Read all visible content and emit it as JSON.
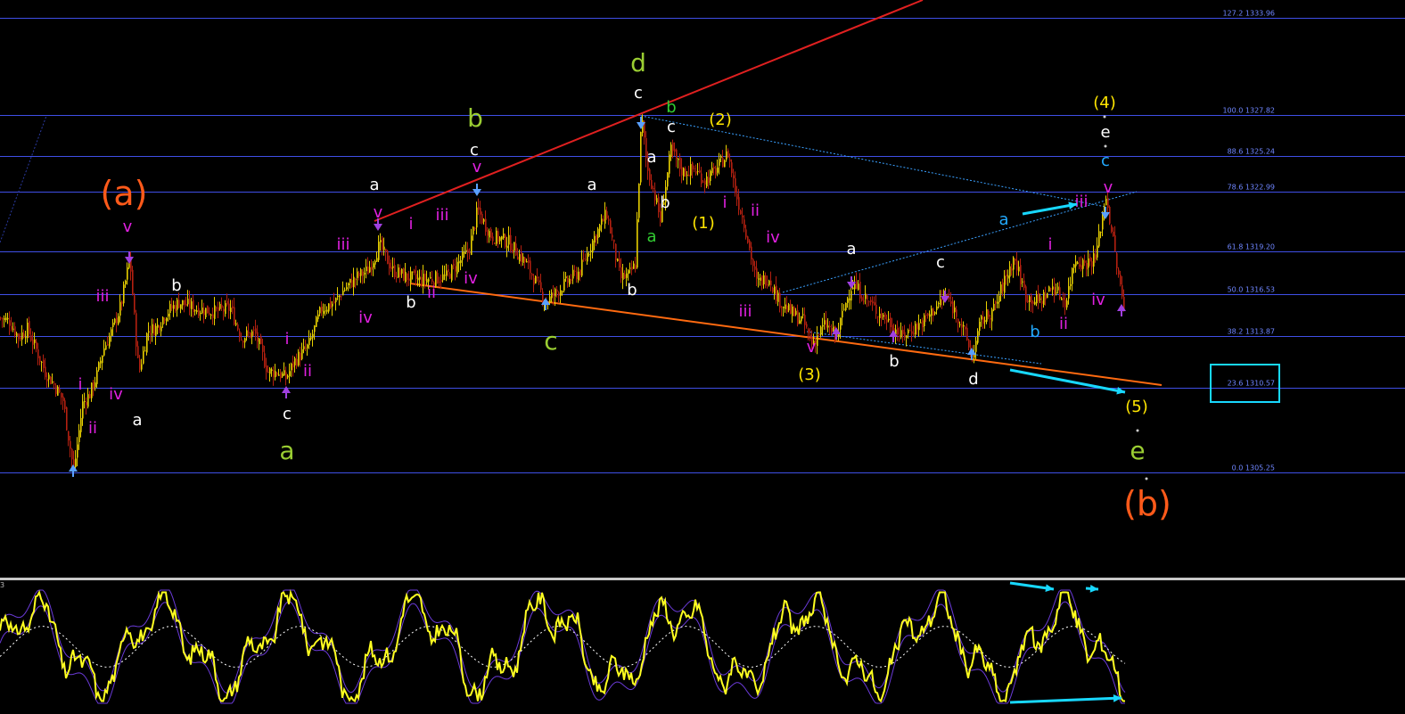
{
  "oscillator": {
    "label": "3"
  },
  "colors": {
    "background": "#000000",
    "fib_line": "#3f4fe6",
    "fib_text": "#6f86ff",
    "up_candle": "#e8d000",
    "down_candle": "#b32010",
    "channel_upper": "#e02020",
    "channel_lower": "#ff6a10",
    "dotted_line": "#3aa0ff",
    "arrow": "#18d8ff",
    "osc_main": "#ffff20",
    "osc_band": "#6a3ad8",
    "osc_signal": "#ffffff"
  },
  "chart_data": {
    "type": "candlestick",
    "fib_levels": [
      {
        "ratio": "127.2",
        "price": "1333.96",
        "label": "127.2 1333.96"
      },
      {
        "ratio": "100.0",
        "price": "1327.82",
        "label": "100.0 1327.82"
      },
      {
        "ratio": "88.6",
        "price": "1325.24",
        "label": "88.6 1325.24"
      },
      {
        "ratio": "78.6",
        "price": "1322.99",
        "label": "78.6 1322.99"
      },
      {
        "ratio": "61.8",
        "price": "1319.20",
        "label": "61.8 1319.20"
      },
      {
        "ratio": "50.0",
        "price": "1316.53",
        "label": "50.0 1316.53"
      },
      {
        "ratio": "38.2",
        "price": "1313.87",
        "label": "38.2 1313.87"
      },
      {
        "ratio": "23.6",
        "price": "1310.57",
        "label": "23.6 1310.57"
      },
      {
        "ratio": "0.0",
        "price": "1305.25",
        "label": "0.0 1305.25"
      }
    ],
    "price_path": [
      [
        0,
        1315.0
      ],
      [
        10,
        1314.8
      ],
      [
        20,
        1313.8
      ],
      [
        30,
        1314.3
      ],
      [
        40,
        1313.0
      ],
      [
        50,
        1311.6
      ],
      [
        60,
        1310.8
      ],
      [
        70,
        1309.8
      ],
      [
        82,
        1305.3
      ],
      [
        92,
        1309.6
      ],
      [
        100,
        1310.2
      ],
      [
        108,
        1311.4
      ],
      [
        115,
        1313.0
      ],
      [
        125,
        1314.2
      ],
      [
        135,
        1315.8
      ],
      [
        145,
        1318.8
      ],
      [
        150,
        1315.0
      ],
      [
        155,
        1311.5
      ],
      [
        165,
        1314.2
      ],
      [
        175,
        1314.4
      ],
      [
        185,
        1315.3
      ],
      [
        200,
        1316.0
      ],
      [
        220,
        1315.6
      ],
      [
        240,
        1315.4
      ],
      [
        258,
        1315.6
      ],
      [
        270,
        1313.8
      ],
      [
        285,
        1314.1
      ],
      [
        300,
        1311.6
      ],
      [
        310,
        1311.6
      ],
      [
        320,
        1311.2
      ],
      [
        330,
        1312.3
      ],
      [
        345,
        1313.2
      ],
      [
        360,
        1315.6
      ],
      [
        375,
        1316.0
      ],
      [
        385,
        1316.8
      ],
      [
        400,
        1317.6
      ],
      [
        412,
        1318.0
      ],
      [
        425,
        1319.6
      ],
      [
        440,
        1318.0
      ],
      [
        455,
        1317.6
      ],
      [
        470,
        1317.4
      ],
      [
        485,
        1317.5
      ],
      [
        500,
        1317.6
      ],
      [
        515,
        1318.6
      ],
      [
        525,
        1319.2
      ],
      [
        535,
        1321.8
      ],
      [
        550,
        1320.2
      ],
      [
        570,
        1319.8
      ],
      [
        590,
        1318.4
      ],
      [
        612,
        1316.0
      ],
      [
        630,
        1317.0
      ],
      [
        650,
        1318.0
      ],
      [
        665,
        1320.0
      ],
      [
        680,
        1321.6
      ],
      [
        695,
        1317.5
      ],
      [
        705,
        1317.7
      ],
      [
        712,
        1318.4
      ],
      [
        719,
        1327.8
      ],
      [
        725,
        1324.5
      ],
      [
        732,
        1323.2
      ],
      [
        740,
        1321.2
      ],
      [
        752,
        1325.6
      ],
      [
        765,
        1324.2
      ],
      [
        778,
        1324.4
      ],
      [
        790,
        1323.7
      ],
      [
        800,
        1324.2
      ],
      [
        816,
        1325.4
      ],
      [
        825,
        1322.8
      ],
      [
        835,
        1320.8
      ],
      [
        848,
        1317.2
      ],
      [
        862,
        1317.6
      ],
      [
        872,
        1316.2
      ],
      [
        885,
        1315.4
      ],
      [
        900,
        1314.8
      ],
      [
        910,
        1313.4
      ],
      [
        925,
        1314.6
      ],
      [
        938,
        1313.8
      ],
      [
        945,
        1315.4
      ],
      [
        955,
        1317.2
      ],
      [
        965,
        1316.6
      ],
      [
        980,
        1315.6
      ],
      [
        1000,
        1314.6
      ],
      [
        1010,
        1313.8
      ],
      [
        1020,
        1314.2
      ],
      [
        1035,
        1314.8
      ],
      [
        1048,
        1315.6
      ],
      [
        1060,
        1316.4
      ],
      [
        1075,
        1315.0
      ],
      [
        1090,
        1312.6
      ],
      [
        1100,
        1314.8
      ],
      [
        1115,
        1315.6
      ],
      [
        1125,
        1317.2
      ],
      [
        1137,
        1318.8
      ],
      [
        1150,
        1316.4
      ],
      [
        1165,
        1316.0
      ],
      [
        1180,
        1317.0
      ],
      [
        1195,
        1316.0
      ],
      [
        1205,
        1318.8
      ],
      [
        1215,
        1318.4
      ],
      [
        1228,
        1318.8
      ],
      [
        1240,
        1322.8
      ],
      [
        1248,
        1319.8
      ],
      [
        1255,
        1317.2
      ],
      [
        1260,
        1315.6
      ]
    ],
    "wave_labels": [
      {
        "text": "(a)",
        "color": "#ff5a1a",
        "size": "large"
      },
      {
        "text": "v",
        "color": "#e020e0",
        "size": "small"
      },
      {
        "text": "iii",
        "color": "#e020e0",
        "size": "small"
      },
      {
        "text": "b",
        "color": "#ffffff",
        "size": "small"
      },
      {
        "text": "i",
        "color": "#e020e0",
        "size": "small"
      },
      {
        "text": "iv",
        "color": "#e020e0",
        "size": "small"
      },
      {
        "text": "ii",
        "color": "#e020e0",
        "size": "small"
      },
      {
        "text": "a",
        "color": "#ffffff",
        "size": "small"
      },
      {
        "text": "i",
        "color": "#e020e0",
        "size": "small"
      },
      {
        "text": "ii",
        "color": "#e020e0",
        "size": "small"
      },
      {
        "text": "c",
        "color": "#ffffff",
        "size": "small"
      },
      {
        "text": "a",
        "color": "#9acd32",
        "size": "medium"
      },
      {
        "text": "iii",
        "color": "#e020e0",
        "size": "small"
      },
      {
        "text": "iv",
        "color": "#e020e0",
        "size": "small"
      },
      {
        "text": "a",
        "color": "#ffffff",
        "size": "small"
      },
      {
        "text": "v",
        "color": "#e020e0",
        "size": "small"
      },
      {
        "text": "i",
        "color": "#e020e0",
        "size": "small"
      },
      {
        "text": "b",
        "color": "#ffffff",
        "size": "small"
      },
      {
        "text": "ii",
        "color": "#e020e0",
        "size": "small"
      },
      {
        "text": "iii",
        "color": "#e020e0",
        "size": "small"
      },
      {
        "text": "iv",
        "color": "#e020e0",
        "size": "small"
      },
      {
        "text": "b",
        "color": "#9acd32",
        "size": "medium"
      },
      {
        "text": "c",
        "color": "#ffffff",
        "size": "small"
      },
      {
        "text": "v",
        "color": "#e020e0",
        "size": "small"
      },
      {
        "text": "c",
        "color": "#9acd32",
        "size": "medium"
      },
      {
        "text": "a",
        "color": "#ffffff",
        "size": "small"
      },
      {
        "text": "b",
        "color": "#ffffff",
        "size": "small"
      },
      {
        "text": "d",
        "color": "#9acd32",
        "size": "medium"
      },
      {
        "text": "c",
        "color": "#ffffff",
        "size": "small"
      },
      {
        "text": "b",
        "color": "#32cd32",
        "size": "small"
      },
      {
        "text": "c",
        "color": "#ffffff",
        "size": "small"
      },
      {
        "text": "a",
        "color": "#ffffff",
        "size": "small"
      },
      {
        "text": "b",
        "color": "#ffffff",
        "size": "small"
      },
      {
        "text": "a",
        "color": "#32cd32",
        "size": "small"
      },
      {
        "text": "(2)",
        "color": "#ffe600",
        "size": "small"
      },
      {
        "text": "(1)",
        "color": "#ffe600",
        "size": "small"
      },
      {
        "text": "i",
        "color": "#e020e0",
        "size": "small"
      },
      {
        "text": "ii",
        "color": "#e020e0",
        "size": "small"
      },
      {
        "text": "iv",
        "color": "#e020e0",
        "size": "small"
      },
      {
        "text": "iii",
        "color": "#e020e0",
        "size": "small"
      },
      {
        "text": "v",
        "color": "#e020e0",
        "size": "small"
      },
      {
        "text": "(3)",
        "color": "#ffe600",
        "size": "small"
      },
      {
        "text": "a",
        "color": "#ffffff",
        "size": "small"
      },
      {
        "text": "b",
        "color": "#ffffff",
        "size": "small"
      },
      {
        "text": "c",
        "color": "#ffffff",
        "size": "small"
      },
      {
        "text": "d",
        "color": "#ffffff",
        "size": "small"
      },
      {
        "text": "a",
        "color": "#22aaff",
        "size": "small"
      },
      {
        "text": "b",
        "color": "#22aaff",
        "size": "small"
      },
      {
        "text": "i",
        "color": "#e020e0",
        "size": "small"
      },
      {
        "text": "ii",
        "color": "#e020e0",
        "size": "small"
      },
      {
        "text": "iii",
        "color": "#e020e0",
        "size": "small"
      },
      {
        "text": "iv",
        "color": "#e020e0",
        "size": "small"
      },
      {
        "text": "v",
        "color": "#e020e0",
        "size": "small"
      },
      {
        "text": "(4)",
        "color": "#ffe600",
        "size": "small"
      },
      {
        "text": "e",
        "color": "#ffffff",
        "size": "small"
      },
      {
        "text": "c",
        "color": "#22aaff",
        "size": "small"
      },
      {
        "text": "(5)",
        "color": "#ffe600",
        "size": "small"
      },
      {
        "text": "e",
        "color": "#9acd32",
        "size": "medium"
      },
      {
        "text": "(b)",
        "color": "#ff5a1a",
        "size": "large"
      }
    ]
  }
}
